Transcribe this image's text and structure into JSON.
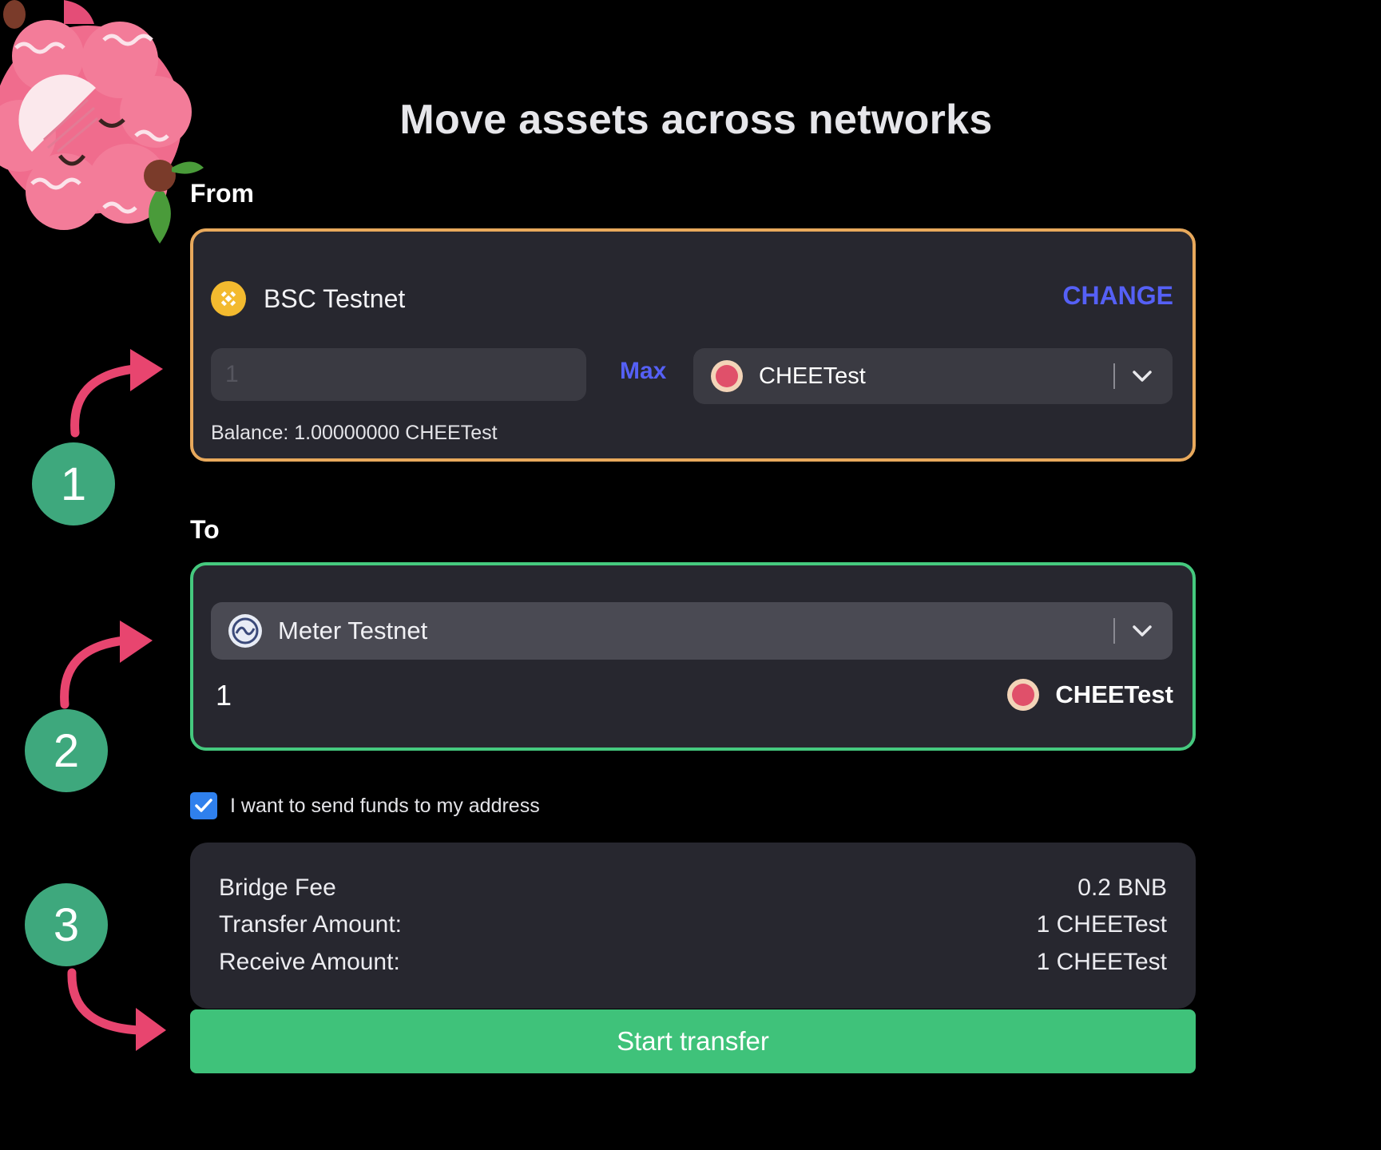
{
  "page": {
    "title": "Move assets across networks"
  },
  "from": {
    "label": "From",
    "network_name": "BSC Testnet",
    "change_label": "CHANGE",
    "amount_placeholder": "1",
    "max_label": "Max",
    "token_name": "CHEETest",
    "balance_text": "Balance: 1.00000000 CHEETest"
  },
  "to": {
    "label": "To",
    "network_name": "Meter Testnet",
    "amount_value": "1",
    "token_name": "CHEETest"
  },
  "checkbox": {
    "label": "I want to send funds to my address",
    "checked": true
  },
  "summary": {
    "rows": [
      {
        "label": "Bridge Fee",
        "value": "0.2 BNB"
      },
      {
        "label": "Transfer Amount:",
        "value": "1 CHEETest"
      },
      {
        "label": "Receive Amount:",
        "value": "1 CHEETest"
      }
    ]
  },
  "start_button_label": "Start transfer",
  "steps": [
    "1",
    "2",
    "3"
  ],
  "colors": {
    "from_border": "#e8a95c",
    "to_border": "#45c97e",
    "accent_link": "#5560f6",
    "primary_button": "#3fc27a",
    "step_circle": "#3ea87d",
    "arrow": "#e8456f"
  },
  "icons": {
    "mascot": "raspberry-mascot",
    "bsc": "bnb-icon",
    "meter": "meter-icon",
    "token": "cheetest-token-icon",
    "dropdown": "chevron-down-icon",
    "check": "checkmark-icon",
    "arrow": "curved-arrow-icon"
  }
}
